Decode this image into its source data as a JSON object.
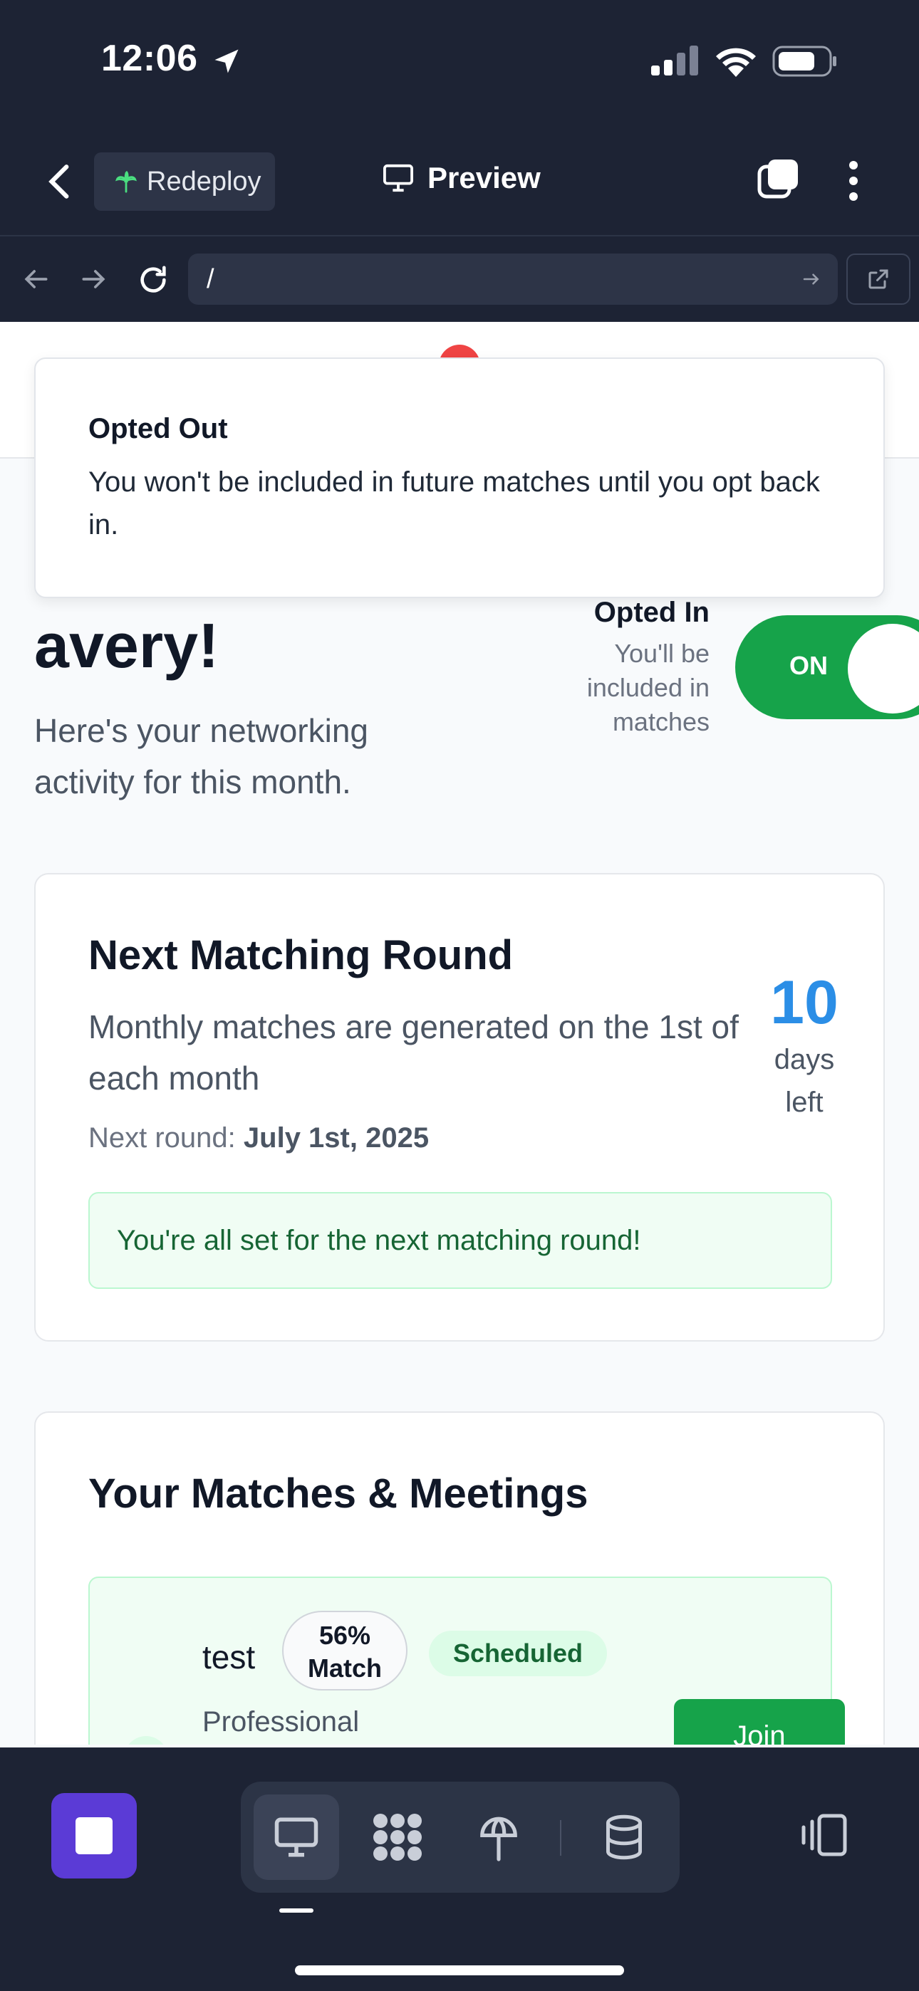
{
  "status_bar": {
    "time": "12:06"
  },
  "header": {
    "redeploy_label": "Redeploy",
    "preview_label": "Preview"
  },
  "url_bar": {
    "path": "/"
  },
  "toast": {
    "title": "Opted Out",
    "message": "You won't be included in future matches until you opt back in."
  },
  "greeting": {
    "title": "avery!",
    "subtitle": "Here's your networking activity for this month."
  },
  "opt": {
    "title": "Opted In",
    "description": "You'll be included in matches",
    "toggle_label": "ON",
    "enabled": true
  },
  "next_round": {
    "title": "Next Matching Round",
    "description": "Monthly matches are generated on the 1st of each month",
    "next_label": "Next round:",
    "next_date": "July 1st, 2025",
    "days_left": "10",
    "days_label": "days left",
    "success_message": "You're all set for the next matching round!"
  },
  "matches": {
    "title": "Your Matches & Meetings",
    "items": [
      {
        "name": "test",
        "match_pct": "56%",
        "match_label": "Match",
        "status": "Scheduled",
        "role": "Professional",
        "action": "Join"
      }
    ]
  },
  "colors": {
    "accent": "#2b8ee6",
    "success": "#16a34a",
    "brand": "#5b3bd6",
    "chrome": "#1d2334"
  },
  "icons": [
    "location-arrow-icon",
    "signal-icon",
    "wifi-icon",
    "battery-icon",
    "chevron-left-icon",
    "palm-tree-icon",
    "monitor-icon",
    "tabs-icon",
    "kebab-menu-icon",
    "arrow-left-icon",
    "arrow-right-icon",
    "reload-icon",
    "external-link-icon",
    "stop-icon",
    "grid-dots-icon",
    "deploy-icon",
    "database-icon",
    "panes-icon"
  ]
}
